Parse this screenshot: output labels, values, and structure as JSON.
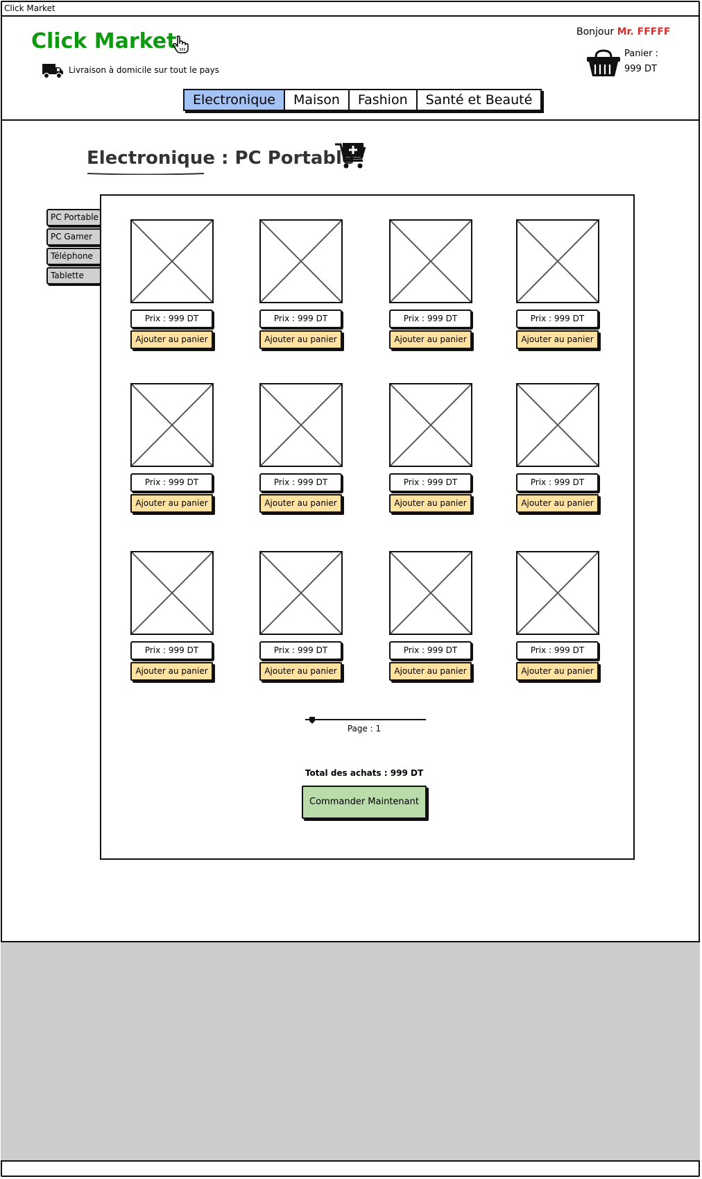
{
  "window": {
    "title": "Click Market"
  },
  "header": {
    "logo": "Click Market",
    "shipping": "Livraison à domicile sur tout le pays",
    "greeting": "Bonjour",
    "user": "Mr. FFFFF",
    "cart_label": "Panier :",
    "cart_value": "999 DT"
  },
  "nav": {
    "tabs": [
      "Electronique",
      "Maison",
      "Fashion",
      "Santé et Beauté"
    ],
    "active": 0
  },
  "page": {
    "category": "Electronique :",
    "subcategory": "PC Portable"
  },
  "sidebar": {
    "items": [
      "PC Portable",
      "PC Gamer",
      "Téléphone",
      "Tablette"
    ]
  },
  "products": [
    {
      "price": "Prix : 999 DT",
      "button": "Ajouter au panier"
    },
    {
      "price": "Prix : 999 DT",
      "button": "Ajouter au panier"
    },
    {
      "price": "Prix : 999 DT",
      "button": "Ajouter au panier"
    },
    {
      "price": "Prix : 999 DT",
      "button": "Ajouter au panier"
    },
    {
      "price": "Prix : 999 DT",
      "button": "Ajouter au panier"
    },
    {
      "price": "Prix : 999 DT",
      "button": "Ajouter au panier"
    },
    {
      "price": "Prix : 999 DT",
      "button": "Ajouter au panier"
    },
    {
      "price": "Prix : 999 DT",
      "button": "Ajouter au panier"
    },
    {
      "price": "Prix : 999 DT",
      "button": "Ajouter au panier"
    },
    {
      "price": "Prix : 999 DT",
      "button": "Ajouter au panier"
    },
    {
      "price": "Prix : 999 DT",
      "button": "Ajouter au panier"
    },
    {
      "price": "Prix : 999 DT",
      "button": "Ajouter au panier"
    }
  ],
  "pagination": {
    "label": "Page : 1"
  },
  "summary": {
    "total": "Total des achats : 999 DT",
    "order_button": "Commander Maintenant"
  },
  "colors": {
    "brand": "#0e9a0e",
    "user": "#d32f2f",
    "active_tab": "#a4c2f4",
    "add_button": "#ffe29f",
    "order_button": "#b9dcaa",
    "footer": "#cccccc"
  }
}
